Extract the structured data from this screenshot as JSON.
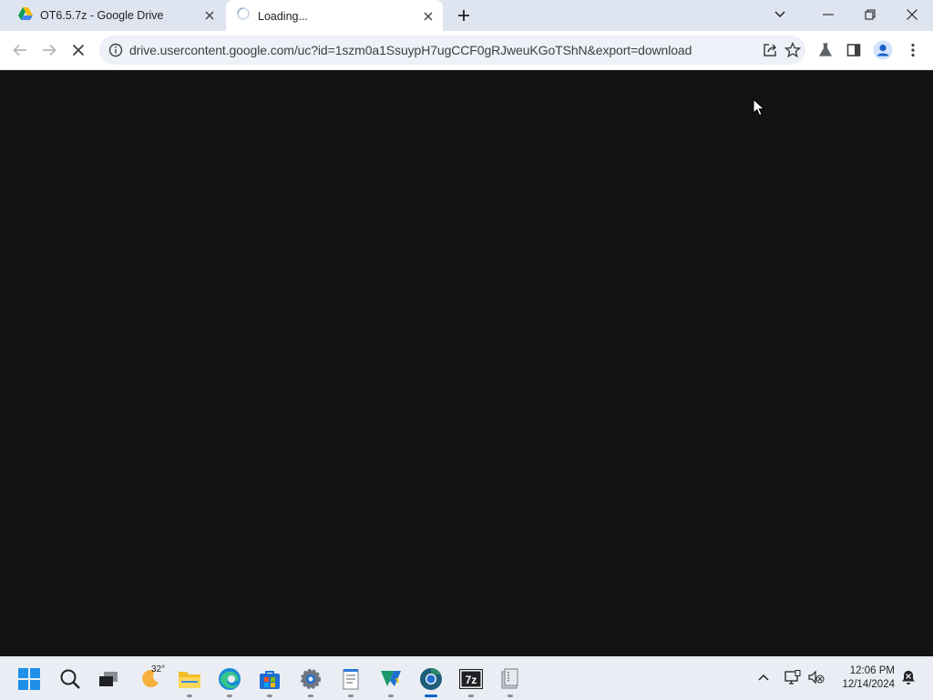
{
  "window": {
    "tabs": [
      {
        "title": "OT6.5.7z - Google Drive",
        "icon": "google-drive-icon",
        "active": false
      },
      {
        "title": "Loading...",
        "icon": "loading-spinner-icon",
        "active": true
      }
    ],
    "controls": [
      "tab-search",
      "minimize",
      "restore",
      "close"
    ]
  },
  "toolbar": {
    "url": "drive.usercontent.google.com/uc?id=1szm0a1SsuypH7ugCCF0gRJweuKGoTShN&export=download",
    "back_enabled": false,
    "forward_enabled": false,
    "loading": true
  },
  "page": {
    "background": "#121212"
  },
  "taskbar": {
    "weather": {
      "temperature": "32°"
    },
    "apps": [
      "start",
      "search",
      "task-view",
      "weather",
      "file-explorer",
      "edge",
      "store",
      "settings",
      "notepad",
      "visual-studio-code",
      "chrome",
      "7zip",
      "archive"
    ],
    "clock": {
      "time": "12:06 PM",
      "date": "12/14/2024"
    }
  },
  "colors": {
    "tabstrip_bg": "#dfe5f0",
    "omnibox_bg": "#eef1f7",
    "taskbar_bg": "#eaeef4",
    "accent_blue": "#0a64c8"
  }
}
